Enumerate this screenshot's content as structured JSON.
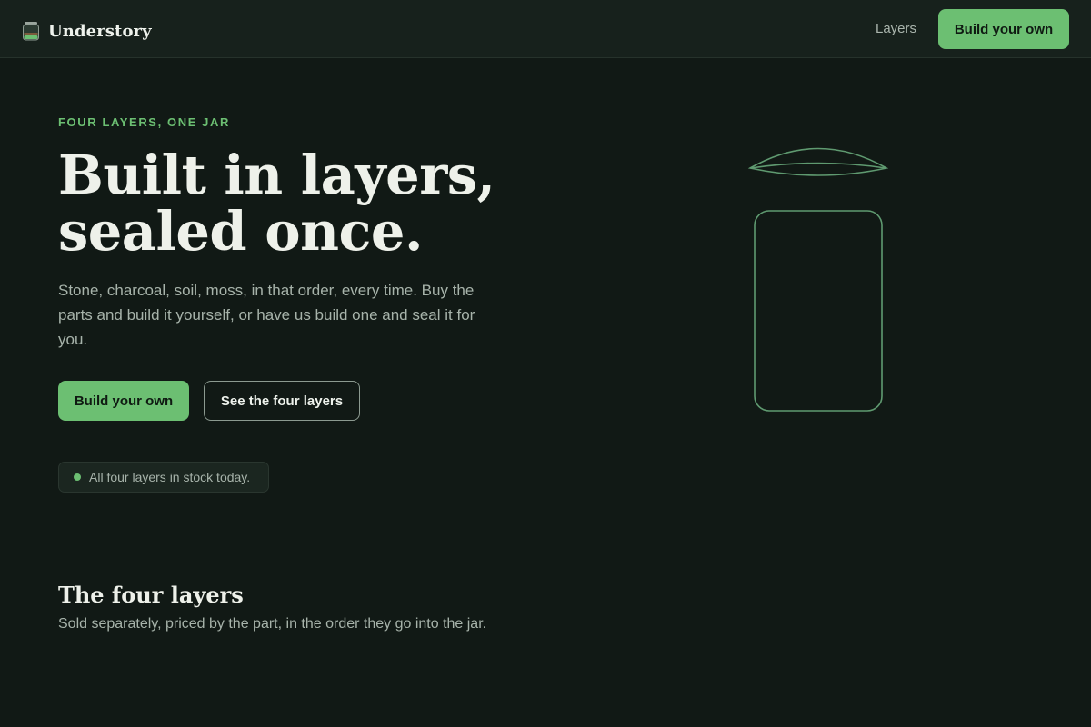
{
  "header": {
    "brand_name": "Understory",
    "nav": {
      "layers_label": "Layers"
    },
    "cta_label": "Build your own"
  },
  "hero": {
    "eyebrow": "FOUR LAYERS, ONE JAR",
    "headline_line1": "Built in layers,",
    "headline_line2": "sealed once.",
    "lede": "Stone, charcoal, soil, moss, in that order, every time. Buy the parts and build it yourself, or have us build one and seal it for you.",
    "primary_cta": "Build your own",
    "secondary_cta": "See the four layers",
    "stock_status": "All four layers in stock today."
  },
  "layers_section": {
    "title": "The four layers",
    "subtitle": "Sold separately, priced by the part, in the order they go into the jar."
  },
  "colors": {
    "background": "#111915",
    "header_background": "#17211c",
    "accent": "#6cbf72",
    "jar_outline": "#5f9a70",
    "text_primary": "#eef1ea",
    "text_muted": "#a7b3aa"
  },
  "icons": {
    "brand_logo": "jar-logo-icon",
    "stock_indicator": "status-dot-icon",
    "hero_illustration": "jar-outline-icon"
  }
}
